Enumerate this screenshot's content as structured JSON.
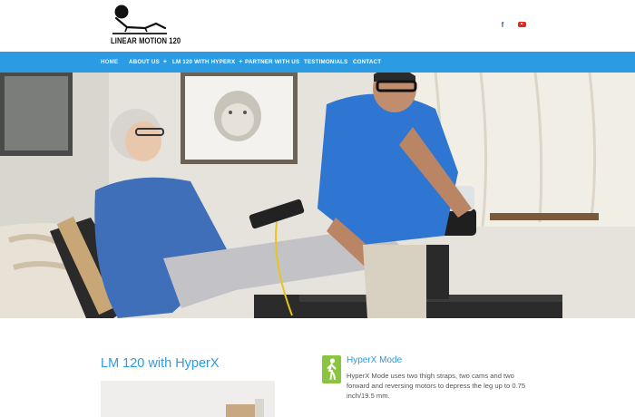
{
  "brand": {
    "logo_text": "LINEAR MOTION 120"
  },
  "social": [
    {
      "name": "facebook-icon",
      "glyph": "f",
      "color": "#3b5998"
    },
    {
      "name": "youtube-icon",
      "glyph": "▶",
      "color": "#e02a20"
    }
  ],
  "nav": {
    "items": [
      {
        "label": "HOME",
        "active": true
      },
      {
        "label": "ABOUT US",
        "submenu": "+"
      },
      {
        "label": "LM 120 WITH HYPERX",
        "submenu": "+"
      },
      {
        "label": "PARTNER WITH US"
      },
      {
        "label": "TESTIMONIALS"
      },
      {
        "label": "CONTACT"
      }
    ]
  },
  "hero": {
    "image": "therapist-fitting-leg-device-photo"
  },
  "main": {
    "section_title": "LM 120 with HyperX",
    "feature": {
      "icon": "walking-person-icon",
      "title": "HyperX Mode",
      "body": "HyperX Mode uses two thigh straps, two cams and two forward and reversing motors to depress the leg up to 0.75 inch/19.5 mm."
    }
  },
  "colors": {
    "accent": "#2b9be3",
    "feature_icon_bg": "#8bc53f"
  }
}
